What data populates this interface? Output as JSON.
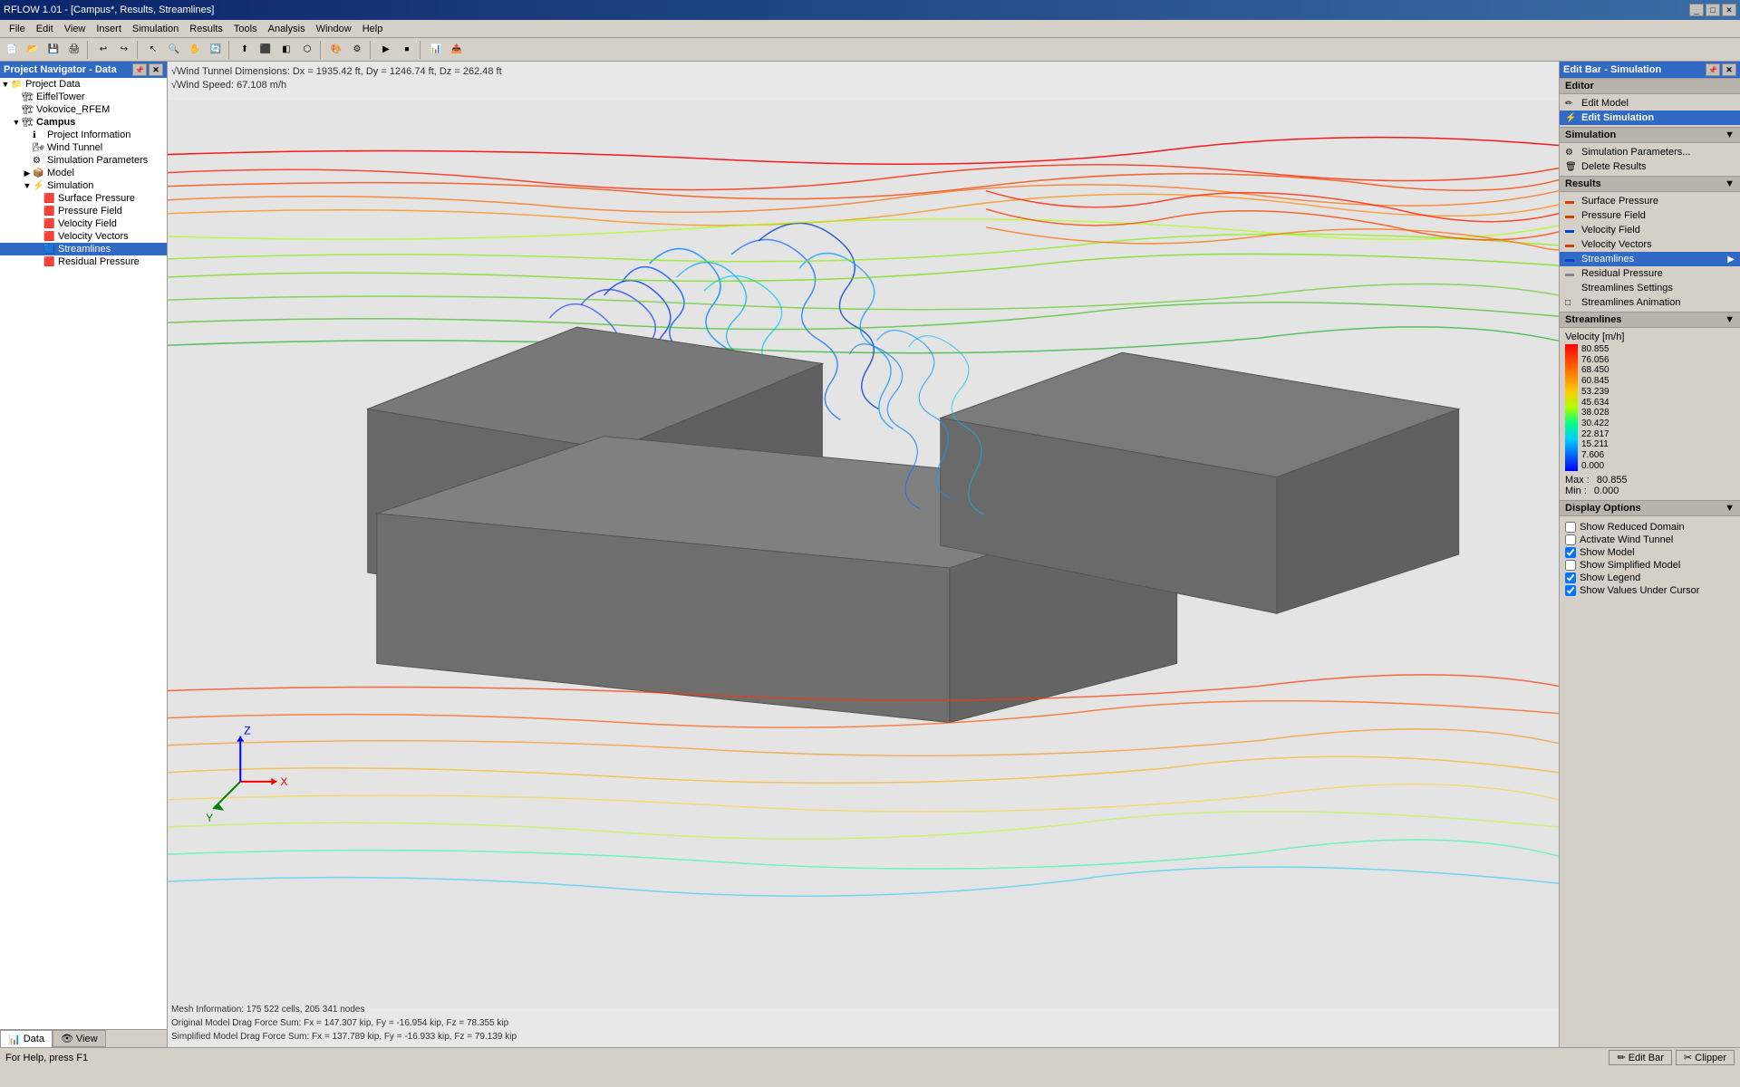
{
  "titlebar": {
    "title": "RFLOW 1.01 - [Campus*, Results, Streamlines]",
    "controls": [
      "_",
      "□",
      "✕"
    ]
  },
  "menubar": {
    "items": [
      "File",
      "Edit",
      "View",
      "Insert",
      "Simulation",
      "Results",
      "Tools",
      "Analysis",
      "Window",
      "Help"
    ]
  },
  "left_panel": {
    "header": "Project Navigator - Data",
    "tree": [
      {
        "indent": 0,
        "expand": "▼",
        "icon": "📁",
        "label": "Project Data",
        "level": 0
      },
      {
        "indent": 1,
        "expand": " ",
        "icon": "🏗",
        "label": "EiffelTower",
        "level": 1
      },
      {
        "indent": 1,
        "expand": " ",
        "icon": "🏗",
        "label": "Vokovice_RFEM",
        "level": 1
      },
      {
        "indent": 1,
        "expand": "▼",
        "icon": "🏗",
        "label": "Campus",
        "level": 1,
        "bold": true
      },
      {
        "indent": 2,
        "expand": " ",
        "icon": "ℹ",
        "label": "Project Information",
        "level": 2
      },
      {
        "indent": 2,
        "expand": " ",
        "icon": "🌬",
        "label": "Wind Tunnel",
        "level": 2
      },
      {
        "indent": 2,
        "expand": " ",
        "icon": "⚙",
        "label": "Simulation Parameters",
        "level": 2
      },
      {
        "indent": 2,
        "expand": "▶",
        "icon": "📦",
        "label": "Model",
        "level": 2
      },
      {
        "indent": 2,
        "expand": "▼",
        "icon": "⚡",
        "label": "Simulation",
        "level": 2
      },
      {
        "indent": 3,
        "expand": " ",
        "icon": "🟥",
        "label": "Surface Pressure",
        "level": 3
      },
      {
        "indent": 3,
        "expand": " ",
        "icon": "🟥",
        "label": "Pressure Field",
        "level": 3
      },
      {
        "indent": 3,
        "expand": " ",
        "icon": "🟥",
        "label": "Velocity Field",
        "level": 3
      },
      {
        "indent": 3,
        "expand": " ",
        "icon": "🟥",
        "label": "Velocity Vectors",
        "level": 3
      },
      {
        "indent": 3,
        "expand": " ",
        "icon": "🟦",
        "label": "Streamlines",
        "level": 3,
        "selected": true
      },
      {
        "indent": 3,
        "expand": " ",
        "icon": "🟥",
        "label": "Residual Pressure",
        "level": 3
      }
    ]
  },
  "viewport": {
    "info_line1": "√Wind Tunnel Dimensions: Dx = 1935.42 ft, Dy = 1246.74 ft, Dz = 262.48 ft",
    "info_line2": "√Wind Speed: 67.108 m/h",
    "bottom_line1": "Mesh Information: 175 522 cells, 205 341 nodes",
    "bottom_line2": "Original Model Drag Force Sum: Fx = 147.307 kip, Fy = -16.954 kip, Fz = 78.355 kip",
    "bottom_line3": "Simplified Model Drag Force Sum: Fx = 137.789 kip, Fy = -16.933 kip, Fz = 79.139 kip"
  },
  "right_panel": {
    "header": "Edit Bar - Simulation",
    "editor_section": "Editor",
    "editor_items": [
      {
        "icon": "✏",
        "label": "Edit Model"
      },
      {
        "icon": "⚡",
        "label": "Edit Simulation",
        "bold": true,
        "selected": true
      }
    ],
    "simulation_section": "Simulation",
    "simulation_items": [
      {
        "icon": "⚙",
        "label": "Simulation Parameters..."
      },
      {
        "icon": "🗑",
        "label": "Delete Results"
      }
    ],
    "results_section": "Results",
    "results_items": [
      {
        "icon": "🟥",
        "label": "Surface Pressure"
      },
      {
        "icon": "🟥",
        "label": "Pressure Field"
      },
      {
        "icon": "🔵",
        "label": "Velocity Field"
      },
      {
        "icon": "🟥",
        "label": "Velocity Vectors"
      },
      {
        "icon": "🟦",
        "label": "Streamlines",
        "selected": true
      },
      {
        "icon": "🟥",
        "label": "Residual Pressure"
      },
      {
        "icon": " ",
        "label": "Streamlines Settings"
      },
      {
        "icon": "□",
        "label": "Streamlines Animation"
      }
    ],
    "streamlines_section": "Streamlines",
    "legend": {
      "title": "Velocity [m/h]",
      "values": [
        "80.855",
        "76.056",
        "68.450",
        "60.845",
        "53.239",
        "45.634",
        "38.028",
        "30.422",
        "22.817",
        "15.211",
        "7.606",
        "0.000"
      ],
      "max_label": "Max :",
      "max_value": "80.855",
      "min_label": "Min :",
      "min_value": "0.000"
    },
    "display_options": {
      "title": "Display Options",
      "items": [
        {
          "label": "Show Reduced Domain",
          "checked": false
        },
        {
          "label": "Activate Wind Tunnel",
          "checked": false
        },
        {
          "label": "Show Model",
          "checked": true
        },
        {
          "label": "Show Simplified Model",
          "checked": false
        },
        {
          "label": "Show Legend",
          "checked": true
        },
        {
          "label": "Show Values Under Cursor",
          "checked": true
        }
      ]
    }
  },
  "bottom_tabs": [
    {
      "label": "Data",
      "icon": "📊",
      "active": false
    },
    {
      "label": "View",
      "icon": "👁",
      "active": false
    }
  ],
  "statusbar": {
    "help_text": "For Help, press F1",
    "right_tabs": [
      {
        "label": "Edit Bar",
        "icon": "✏"
      },
      {
        "label": "Clipper",
        "icon": "✂"
      }
    ]
  }
}
